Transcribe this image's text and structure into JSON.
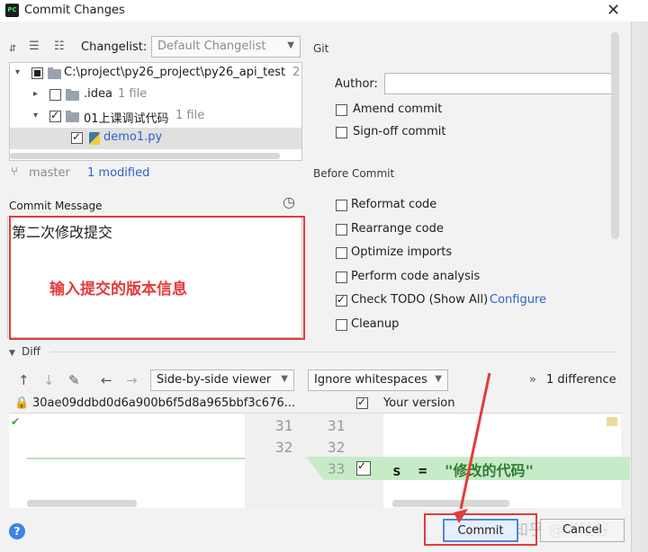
{
  "window": {
    "title": "Commit Changes",
    "app_icon_text": "PC"
  },
  "toolbar": {
    "changelist_label": "Changelist:",
    "changelist_value": "Default Changelist"
  },
  "tree": {
    "rows": [
      {
        "label": "C:\\project\\py26_project\\py26_api_test",
        "extra": "2"
      },
      {
        "label": ".idea",
        "extra": "1 file"
      },
      {
        "label": "01上课调试代码",
        "extra": "1 file"
      },
      {
        "label": "demo1.py",
        "extra": ""
      }
    ]
  },
  "branch": {
    "name": "master",
    "modified": "1 modified"
  },
  "commit": {
    "label": "Commit Message",
    "message": "第二次修改提交",
    "annotation": "输入提交的版本信息"
  },
  "git": {
    "title": "Git",
    "author_label": "Author:",
    "amend_label": "Amend commit",
    "signoff_label": "Sign-off commit"
  },
  "before_commit": {
    "title": "Before Commit",
    "options": [
      {
        "label": "Reformat code",
        "checked": false
      },
      {
        "label": "Rearrange code",
        "checked": false
      },
      {
        "label": "Optimize imports",
        "checked": false
      },
      {
        "label": "Perform code analysis",
        "checked": false
      },
      {
        "label": "Check TODO (Show All)",
        "checked": true
      },
      {
        "label": "Cleanup",
        "checked": false
      }
    ],
    "configure_label": "Configure"
  },
  "diff": {
    "title": "Diff",
    "viewer_value": "Side-by-side viewer",
    "whitespace_value": "Ignore whitespaces",
    "difference_count": "1 difference",
    "hash": "30ae09ddbd0d6a900b6f5d8a965bbf3c676...",
    "your_version": "Your version",
    "left_lines": [
      "31",
      "32"
    ],
    "right_lines": [
      "31",
      "32",
      "33"
    ],
    "code_var": "s",
    "code_eq": "=",
    "code_str": "\"修改的代码\""
  },
  "buttons": {
    "commit_label": "Commit",
    "cancel_label": "Cancel",
    "help_glyph": "?"
  },
  "watermark": "知乎 @尚硅谷",
  "colors": {
    "accent": "#4a89dc",
    "annotation_red": "#e53a3a",
    "diff_green": "#c7ebc7",
    "link": "#2c63c8"
  }
}
